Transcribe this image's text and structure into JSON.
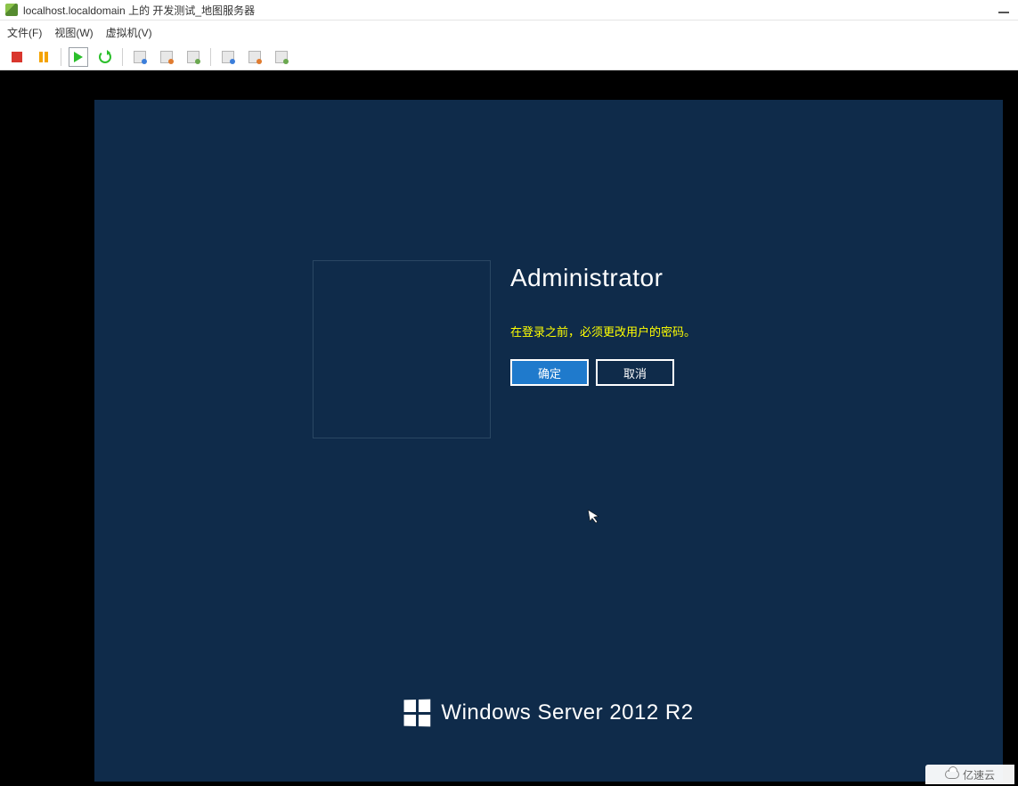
{
  "window": {
    "title": "localhost.localdomain 上的 开发测试_地图服务器"
  },
  "menu": {
    "file": "文件(F)",
    "view": "视图(W)",
    "vm": "虚拟机(V)"
  },
  "toolbar_icons": {
    "stop": "stop-icon",
    "pause": "pause-icon",
    "play": "play-icon",
    "refresh": "refresh-icon",
    "snapshot": "snapshot-icon",
    "snapshot_manager": "snapshot-manager-icon",
    "revert": "revert-icon",
    "cdrom": "cdrom-icon",
    "floppy": "floppy-icon",
    "usb": "usb-icon"
  },
  "login": {
    "username": "Administrator",
    "warning": "在登录之前，必须更改用户的密码。",
    "ok": "确定",
    "cancel": "取消"
  },
  "branding": {
    "product": "Windows Server",
    "version": "2012 R2"
  },
  "watermark": {
    "text": "亿速云"
  }
}
